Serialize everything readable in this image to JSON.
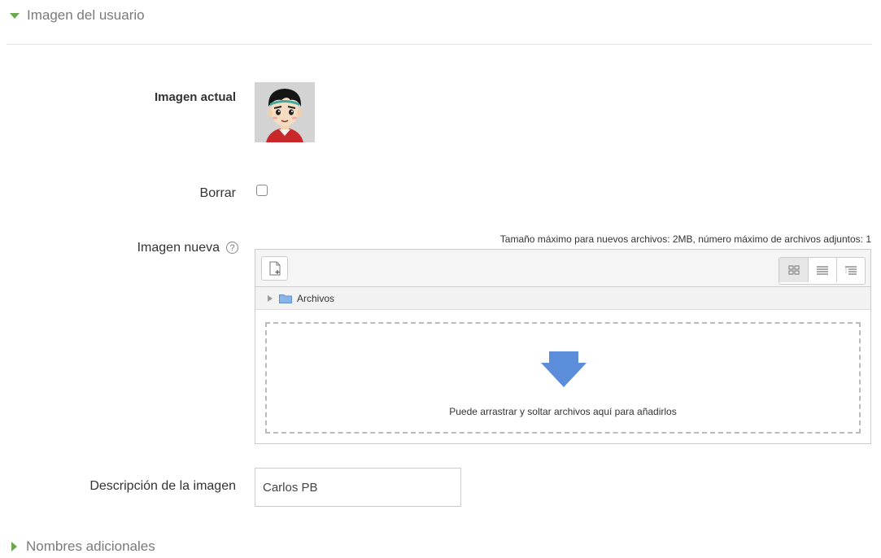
{
  "sections": {
    "user_picture": "Imagen del usuario",
    "additional_names": "Nombres adicionales"
  },
  "current_picture": {
    "label": "Imagen actual"
  },
  "delete": {
    "label": "Borrar",
    "checked": false
  },
  "new_picture": {
    "label": "Imagen nueva",
    "help_glyph": "?",
    "max_info": "Tamaño máximo para nuevos archivos: 2MB, número máximo de archivos adjuntos: 1",
    "path_folder": "Archivos",
    "drop_text": "Puede arrastrar y soltar archivos aquí para añadirlos"
  },
  "image_description": {
    "label": "Descripción de la imagen",
    "value": "Carlos PB"
  },
  "colors": {
    "accent_triangle": "#6aa84f",
    "drop_arrow": "#5b8ddb",
    "folder": "#8ab4e8"
  },
  "icons": [
    "chevron-down-icon",
    "chevron-right-icon",
    "add-file-icon",
    "view-icons-icon",
    "view-details-icon",
    "view-tree-icon",
    "folder-icon",
    "help-icon",
    "drop-arrow-icon"
  ]
}
